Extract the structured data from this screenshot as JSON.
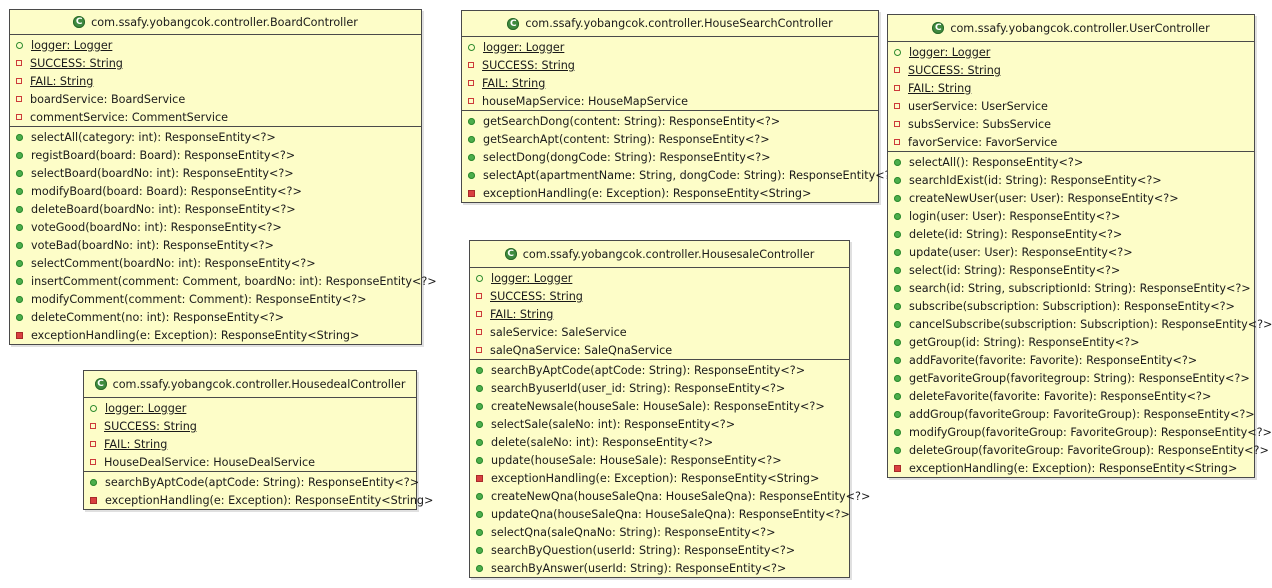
{
  "classes": [
    {
      "name": "com.ssafy.yobangcok.controller.BoardController",
      "attributes": [
        {
          "text": "logger: Logger",
          "visibility": "package",
          "static": true
        },
        {
          "text": "SUCCESS: String",
          "visibility": "private",
          "static": true
        },
        {
          "text": "FAIL: String",
          "visibility": "private",
          "static": true
        },
        {
          "text": "boardService: BoardService",
          "visibility": "private",
          "static": false
        },
        {
          "text": "commentService: CommentService",
          "visibility": "private",
          "static": false
        }
      ],
      "methods": [
        {
          "text": "selectAll(category: int): ResponseEntity<?>",
          "visibility": "public"
        },
        {
          "text": "registBoard(board: Board): ResponseEntity<?>",
          "visibility": "public"
        },
        {
          "text": "selectBoard(boardNo: int): ResponseEntity<?>",
          "visibility": "public"
        },
        {
          "text": "modifyBoard(board: Board): ResponseEntity<?>",
          "visibility": "public"
        },
        {
          "text": "deleteBoard(boardNo: int): ResponseEntity<?>",
          "visibility": "public"
        },
        {
          "text": "voteGood(boardNo: int): ResponseEntity<?>",
          "visibility": "public"
        },
        {
          "text": "voteBad(boardNo: int): ResponseEntity<?>",
          "visibility": "public"
        },
        {
          "text": "selectComment(boardNo: int): ResponseEntity<?>",
          "visibility": "public"
        },
        {
          "text": "insertComment(comment: Comment, boardNo: int): ResponseEntity<?>",
          "visibility": "public"
        },
        {
          "text": "modifyComment(comment: Comment): ResponseEntity<?>",
          "visibility": "public"
        },
        {
          "text": "deleteComment(no: int): ResponseEntity<?>",
          "visibility": "public"
        },
        {
          "text": "exceptionHandling(e: Exception): ResponseEntity<String>",
          "visibility": "private"
        }
      ]
    },
    {
      "name": "com.ssafy.yobangcok.controller.HouseSearchController",
      "attributes": [
        {
          "text": "logger: Logger",
          "visibility": "package",
          "static": true
        },
        {
          "text": "SUCCESS: String",
          "visibility": "private",
          "static": true
        },
        {
          "text": "FAIL: String",
          "visibility": "private",
          "static": true
        },
        {
          "text": "houseMapService: HouseMapService",
          "visibility": "private",
          "static": false
        }
      ],
      "methods": [
        {
          "text": "getSearchDong(content: String): ResponseEntity<?>",
          "visibility": "public"
        },
        {
          "text": "getSearchApt(content: String): ResponseEntity<?>",
          "visibility": "public"
        },
        {
          "text": "selectDong(dongCode: String): ResponseEntity<?>",
          "visibility": "public"
        },
        {
          "text": "selectApt(apartmentName: String, dongCode: String): ResponseEntity<?>",
          "visibility": "public"
        },
        {
          "text": "exceptionHandling(e: Exception): ResponseEntity<String>",
          "visibility": "private"
        }
      ]
    },
    {
      "name": "com.ssafy.yobangcok.controller.UserController",
      "attributes": [
        {
          "text": "logger: Logger",
          "visibility": "package",
          "static": true
        },
        {
          "text": "SUCCESS: String",
          "visibility": "private",
          "static": true
        },
        {
          "text": "FAIL: String",
          "visibility": "private",
          "static": true
        },
        {
          "text": "userService: UserService",
          "visibility": "private",
          "static": false
        },
        {
          "text": "subsService: SubsService",
          "visibility": "private",
          "static": false
        },
        {
          "text": "favorService: FavorService",
          "visibility": "private",
          "static": false
        }
      ],
      "methods": [
        {
          "text": "selectAll(): ResponseEntity<?>",
          "visibility": "public"
        },
        {
          "text": "searchIdExist(id: String): ResponseEntity<?>",
          "visibility": "public"
        },
        {
          "text": "createNewUser(user: User): ResponseEntity<?>",
          "visibility": "public"
        },
        {
          "text": "login(user: User): ResponseEntity<?>",
          "visibility": "public"
        },
        {
          "text": "delete(id: String): ResponseEntity<?>",
          "visibility": "public"
        },
        {
          "text": "update(user: User): ResponseEntity<?>",
          "visibility": "public"
        },
        {
          "text": "select(id: String): ResponseEntity<?>",
          "visibility": "public"
        },
        {
          "text": "search(id: String, subscriptionId: String): ResponseEntity<?>",
          "visibility": "public"
        },
        {
          "text": "subscribe(subscription: Subscription): ResponseEntity<?>",
          "visibility": "public"
        },
        {
          "text": "cancelSubscribe(subscription: Subscription): ResponseEntity<?>",
          "visibility": "public"
        },
        {
          "text": "getGroup(id: String): ResponseEntity<?>",
          "visibility": "public"
        },
        {
          "text": "addFavorite(favorite: Favorite): ResponseEntity<?>",
          "visibility": "public"
        },
        {
          "text": "getFavoriteGroup(favoritegroup: String): ResponseEntity<?>",
          "visibility": "public"
        },
        {
          "text": "deleteFavorite(favorite: Favorite): ResponseEntity<?>",
          "visibility": "public"
        },
        {
          "text": "addGroup(favoriteGroup: FavoriteGroup): ResponseEntity<?>",
          "visibility": "public"
        },
        {
          "text": "modifyGroup(favoriteGroup: FavoriteGroup): ResponseEntity<?>",
          "visibility": "public"
        },
        {
          "text": "deleteGroup(favoriteGroup: FavoriteGroup): ResponseEntity<?>",
          "visibility": "public"
        },
        {
          "text": "exceptionHandling(e: Exception): ResponseEntity<String>",
          "visibility": "private"
        }
      ]
    },
    {
      "name": "com.ssafy.yobangcok.controller.HousesaleController",
      "attributes": [
        {
          "text": "logger: Logger",
          "visibility": "package",
          "static": true
        },
        {
          "text": "SUCCESS: String",
          "visibility": "private",
          "static": true
        },
        {
          "text": "FAIL: String",
          "visibility": "private",
          "static": true
        },
        {
          "text": "saleService: SaleService",
          "visibility": "private",
          "static": false
        },
        {
          "text": "saleQnaService: SaleQnaService",
          "visibility": "private",
          "static": false
        }
      ],
      "methods": [
        {
          "text": "searchByAptCode(aptCode: String): ResponseEntity<?>",
          "visibility": "public"
        },
        {
          "text": "searchByuserId(user_id: String): ResponseEntity<?>",
          "visibility": "public"
        },
        {
          "text": "createNewsale(houseSale: HouseSale): ResponseEntity<?>",
          "visibility": "public"
        },
        {
          "text": "selectSale(saleNo: int): ResponseEntity<?>",
          "visibility": "public"
        },
        {
          "text": "delete(saleNo: int): ResponseEntity<?>",
          "visibility": "public"
        },
        {
          "text": "update(houseSale: HouseSale): ResponseEntity<?>",
          "visibility": "public"
        },
        {
          "text": "exceptionHandling(e: Exception): ResponseEntity<String>",
          "visibility": "private"
        },
        {
          "text": "createNewQna(houseSaleQna: HouseSaleQna): ResponseEntity<?>",
          "visibility": "public"
        },
        {
          "text": "updateQna(houseSaleQna: HouseSaleQna): ResponseEntity<?>",
          "visibility": "public"
        },
        {
          "text": "selectQna(saleQnaNo: String): ResponseEntity<?>",
          "visibility": "public"
        },
        {
          "text": "searchByQuestion(userId: String): ResponseEntity<?>",
          "visibility": "public"
        },
        {
          "text": "searchByAnswer(userId: String): ResponseEntity<?>",
          "visibility": "public"
        }
      ]
    },
    {
      "name": "com.ssafy.yobangcok.controller.HousedealController",
      "attributes": [
        {
          "text": "logger: Logger",
          "visibility": "package",
          "static": true
        },
        {
          "text": "SUCCESS: String",
          "visibility": "private",
          "static": true
        },
        {
          "text": "FAIL: String",
          "visibility": "private",
          "static": true
        },
        {
          "text": "HouseDealService: HouseDealService",
          "visibility": "private",
          "static": false
        }
      ],
      "methods": [
        {
          "text": "searchByAptCode(aptCode: String): ResponseEntity<?>",
          "visibility": "public"
        },
        {
          "text": "exceptionHandling(e: Exception): ResponseEntity<String>",
          "visibility": "private"
        }
      ]
    }
  ]
}
